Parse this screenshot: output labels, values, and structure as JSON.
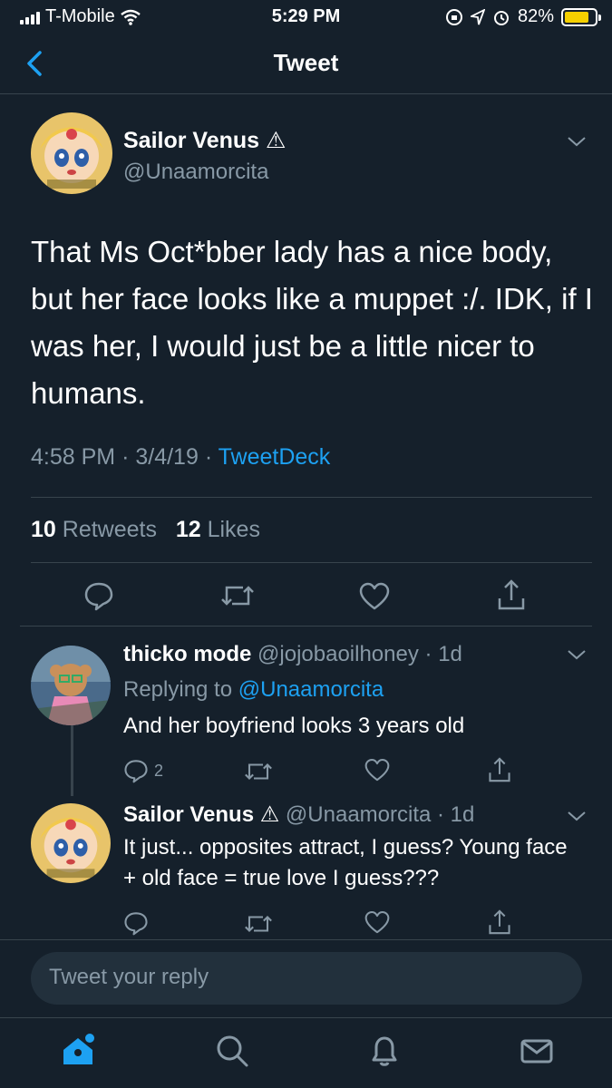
{
  "status_bar": {
    "carrier": "T-Mobile",
    "time": "5:29 PM",
    "battery_percent": "82%",
    "battery_level": 0.82
  },
  "header": {
    "title": "Tweet"
  },
  "main_tweet": {
    "name": "Sailor Venus ⚠",
    "handle": "@Unaamorcita",
    "text": "That Ms Oct*bber lady has a nice body, but her face looks like a muppet :/. IDK, if I was her, I would just be a little nicer to humans.",
    "time": "4:58 PM",
    "date": "3/4/19",
    "source": "TweetDeck",
    "retweets_count": "10",
    "retweets_label": "Retweets",
    "likes_count": "12",
    "likes_label": "Likes"
  },
  "replies": [
    {
      "name": "thicko mode",
      "handle": "@jojobaoilhoney",
      "age": "1d",
      "replying_label": "Replying to",
      "replying_handle": "@Unaamorcita",
      "text": "And her boyfriend looks 3 years old",
      "reply_count": "2"
    },
    {
      "name": "Sailor Venus ⚠",
      "handle": "@Unaamorcita",
      "age": "1d",
      "text": "It just... opposites attract, I guess? Young face + old face = true love I guess???"
    }
  ],
  "compose": {
    "placeholder": "Tweet your reply"
  },
  "icons": {
    "back": "chevron-left-icon",
    "reply": "speech-bubble-icon",
    "retweet": "retweet-icon",
    "like": "heart-icon",
    "share": "share-icon",
    "home": "home-icon",
    "search": "search-icon",
    "notifications": "bell-icon",
    "messages": "mail-icon"
  },
  "colors": {
    "background": "#15202b",
    "accent": "#1da1f2",
    "muted": "#8899a6",
    "battery": "#f5d000"
  }
}
